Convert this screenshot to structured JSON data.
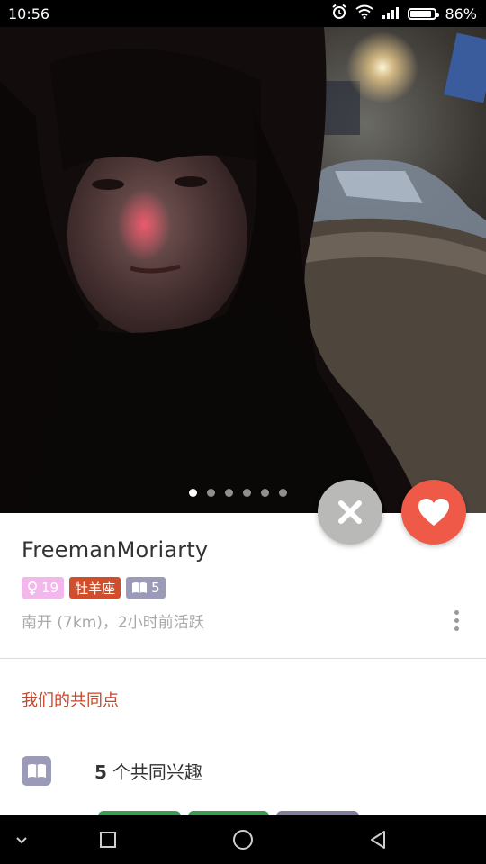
{
  "status_bar": {
    "time": "10:56",
    "battery_percent": "86%",
    "battery_level": 0.86,
    "icons": [
      "alarm-icon",
      "wifi-icon",
      "signal-icon",
      "battery-icon"
    ]
  },
  "photo": {
    "current_index": 1,
    "total": 6
  },
  "actions": {
    "pass_icon": "close-icon",
    "like_icon": "heart-icon",
    "pass_color": "#b9b9b7",
    "like_color": "#ee5a47"
  },
  "profile": {
    "name": "FreemanMoriarty",
    "age": "19",
    "gender_icon": "female-icon",
    "zodiac": "牡羊座",
    "books_count": "5",
    "meta": "南开 (7km)，2小时前活跃"
  },
  "common": {
    "title": "我们的共同点",
    "interests_count": "5",
    "interests_label": "个共同兴趣"
  },
  "colors": {
    "accent": "#c9442a",
    "badge_gender": "#f2b8ec",
    "badge_zodiac": "#d04e2c",
    "badge_books": "#9b9bb8"
  },
  "nav_bar": {
    "icons": [
      "chevron-down-icon",
      "recent-apps-icon",
      "home-icon",
      "back-icon"
    ]
  }
}
